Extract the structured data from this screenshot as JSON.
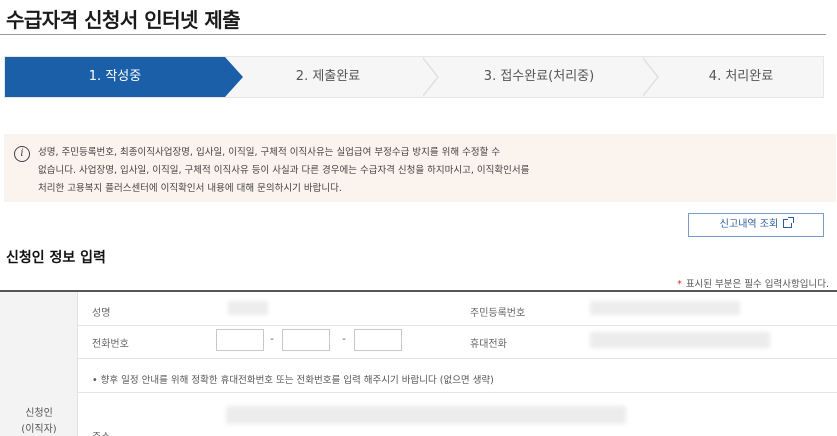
{
  "page": {
    "title": "수급자격 신청서 인터넷 제출"
  },
  "steps": [
    {
      "label": "1. 작성중",
      "active": true
    },
    {
      "label": "2. 제출완료",
      "active": false
    },
    {
      "label": "3. 접수완료(처리중)",
      "active": false
    },
    {
      "label": "4. 처리완료",
      "active": false
    }
  ],
  "notice": {
    "icon": "info-icon",
    "lines": [
      "성명, 주민등록번호, 최종이직사업장명, 입사일, 이직일, 구체적 이직사유는 실업급여 부정수급 방지를 위해 수정할 수",
      "없습니다. 사업장명, 입사일, 이직일, 구체적 이직사유 등이 사실과 다른 경우에는 수급자격 신청을 하지마시고, 이직확인서를",
      "처리한 고용복지 플러스센터에 이직확인서 내용에 대해 문의하시기 바랍니다."
    ]
  },
  "history_button": {
    "label": "신고내역 조회",
    "icon": "external-link-icon"
  },
  "section": {
    "title": "신청인 정보 입력",
    "required_note": "표시된 부분은 필수 입력사항입니다."
  },
  "form": {
    "side_header": [
      "신청인",
      "(이직자)"
    ],
    "name_label": "성명",
    "rrn_label": "주민등록번호",
    "phone_label": "전화번호",
    "phone_separator": "-",
    "mobile_label": "휴대전화",
    "phone_hint": "• 향후 일정 안내를 위해 정확한 휴대전화번호 또는 전화번호를 입력 해주시기 바랍니다 (없으면 생략)",
    "address_label": "주소"
  },
  "colors": {
    "active_step": "#1b5fa8",
    "notice_bg": "#fbf3ee",
    "required_star": "#d9302c"
  }
}
